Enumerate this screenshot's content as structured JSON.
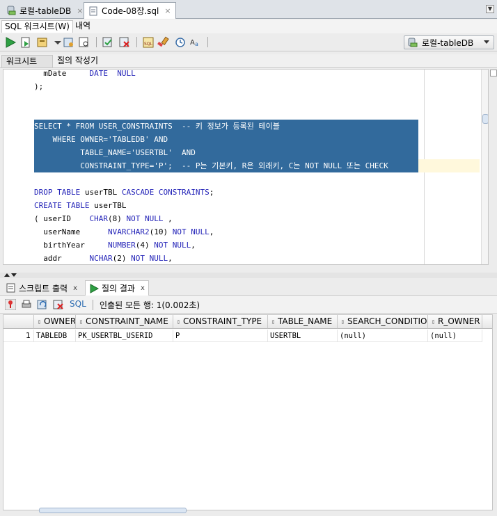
{
  "doc_tabs": [
    {
      "label": "로컬-tableDB",
      "active": false
    },
    {
      "label": "Code-08장.sql",
      "active": true
    }
  ],
  "sub_tabs": [
    {
      "label": "SQL 워크시트(W)",
      "active": true
    },
    {
      "label": "내역",
      "active": false
    }
  ],
  "toolbar": {
    "connection_label": "로컬-tableDB",
    "icons": [
      "run-statement-icon",
      "run-script-icon",
      "autotrace-icon",
      "explain-plan-icon",
      "sql-tuning-icon",
      "commit-icon",
      "rollback-icon",
      "unshared-sql-icon",
      "clear-icon",
      "history-icon",
      "format-icon"
    ]
  },
  "worksheet_tabs": [
    {
      "label": "워크시트",
      "active": true
    },
    {
      "label": "질의 작성기",
      "active": false
    }
  ],
  "editor": {
    "lines": [
      "  mDate     DATE  NULL",
      ");",
      "",
      "",
      "SELECT * FROM USER_CONSTRAINTS  -- 키 정보가 등록된 테이블",
      "    WHERE OWNER='TABLEDB' AND",
      "          TABLE_NAME='USERTBL'  AND",
      "          CONSTRAINT_TYPE='P';  -- P는 기본키, R은 외래키, C는 NOT NULL 또는 CHECK",
      "",
      "DROP TABLE userTBL CASCADE CONSTRAINTS;",
      "CREATE TABLE userTBL",
      "( userID    CHAR(8) NOT NULL ,",
      "  userName      NVARCHAR2(10) NOT NULL,",
      "  birthYear     NUMBER(4) NOT NULL,",
      "  addr      NCHAR(2) NOT NULL,"
    ]
  },
  "output_tabs": [
    {
      "label": "스크립트 출력",
      "close": "x",
      "active": false
    },
    {
      "label": "질의 결과",
      "close": "x",
      "active": true
    }
  ],
  "result_toolbar": {
    "sql_label": "SQL",
    "status_text": "인출된 모든 행: 1(0.002초)"
  },
  "grid": {
    "columns": [
      "OWNER",
      "CONSTRAINT_NAME",
      "CONSTRAINT_TYPE",
      "TABLE_NAME",
      "SEARCH_CONDITION",
      "R_OWNER"
    ],
    "rows": [
      {
        "num": "1",
        "cells": [
          "TABLEDB",
          "PK_USERTBL_USERID",
          "P",
          "USERTBL",
          "(null)",
          "(null)"
        ]
      }
    ]
  }
}
